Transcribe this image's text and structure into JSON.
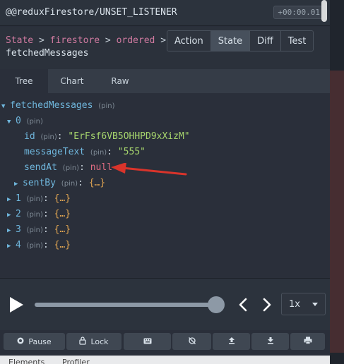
{
  "action": {
    "name": "@@reduxFirestore/UNSET_LISTENER",
    "time": "+00:00.01"
  },
  "breadcrumb": {
    "items": [
      "State",
      "firestore",
      "ordered"
    ],
    "separator": ">",
    "last": "fetchedMessages"
  },
  "mode_tabs": [
    {
      "label": "Action",
      "active": false
    },
    {
      "label": "State",
      "active": true
    },
    {
      "label": "Diff",
      "active": false
    },
    {
      "label": "Test",
      "active": false
    }
  ],
  "view_tabs": [
    {
      "label": "Tree",
      "active": true
    },
    {
      "label": "Chart",
      "active": false
    },
    {
      "label": "Raw",
      "active": false
    }
  ],
  "tree": {
    "root_key": "fetchedMessages",
    "pin": "(pin)",
    "item0_key": "0",
    "id_key": "id",
    "id_value": "\"ErFsf6VB5OHHPD9xXizM\"",
    "messageText_key": "messageText",
    "messageText_value": "\"555\"",
    "sendAt_key": "sendAt",
    "sendAt_value": "null",
    "sentBy_key": "sentBy",
    "collapsed_value": "{…}",
    "item1_key": "1",
    "item2_key": "2",
    "item3_key": "3",
    "item4_key": "4"
  },
  "slider": {
    "speed": "1x",
    "position": 1.0
  },
  "buttons": {
    "pause": "Pause",
    "lock": "Lock"
  },
  "devtools": {
    "tabs": [
      "Elements",
      "Profiler"
    ]
  },
  "colors": {
    "accent_link": "#d07aa0",
    "key": "#6fb6dc",
    "string": "#a6d56d",
    "null": "#e06c82",
    "object": "#e0a552",
    "annotation_arrow": "#d9342b"
  },
  "icons": {
    "pause": "record-icon",
    "lock": "lock-icon",
    "dispatch": "keyboard-icon",
    "persist": "slashed-icon",
    "import": "upload-icon",
    "export": "download-icon",
    "print": "print-icon"
  }
}
